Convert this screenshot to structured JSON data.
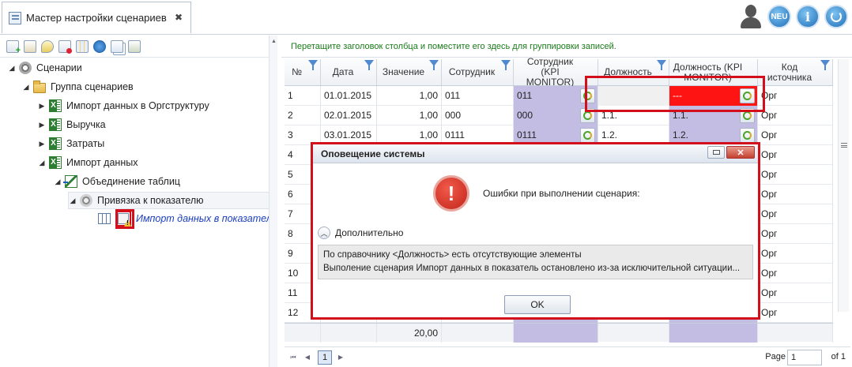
{
  "tab": {
    "title": "Мастер настройки сценариев",
    "close": "✖"
  },
  "top_icons": [
    "user-icon",
    "new-icon",
    "info-icon",
    "power-icon"
  ],
  "top_icon_text": {
    "new": "NEU",
    "info": "i"
  },
  "tree": {
    "root": "Сценарии",
    "group": "Группа сценариев",
    "items": [
      "Импорт данных в Оргструктуру",
      "Выручка",
      "Затраты",
      "Импорт данных"
    ],
    "merge": "Объединение таблиц",
    "bind": "Привязка к показателю",
    "import": "Импорт данных в показатель"
  },
  "grouping_hint": "Перетащите заголовок столбца и поместите его здесь для группировки записей.",
  "columns": [
    "№",
    "Дата",
    "Значение",
    "Сотрудник",
    "Сотрудник (KPI MONITOR)",
    "Должность",
    "Должность (KPI MONITOR)",
    "Код источника"
  ],
  "rows": [
    {
      "n": "1",
      "date": "01.01.2015",
      "value": "1,00",
      "emp": "011",
      "emp_kpi": "011",
      "pos": "",
      "pos_kpi": "---",
      "src": "Орг"
    },
    {
      "n": "2",
      "date": "02.01.2015",
      "value": "1,00",
      "emp": "000",
      "emp_kpi": "000",
      "pos": "1.1.",
      "pos_kpi": "1.1.",
      "src": "Орг"
    },
    {
      "n": "3",
      "date": "03.01.2015",
      "value": "1,00",
      "emp": "0111",
      "emp_kpi": "0111",
      "pos": "1.2.",
      "pos_kpi": "1.2.",
      "src": "Орг"
    },
    {
      "n": "4",
      "src": "Орг"
    },
    {
      "n": "5",
      "src": "Орг"
    },
    {
      "n": "6",
      "src": "Орг"
    },
    {
      "n": "7",
      "src": "Орг"
    },
    {
      "n": "8",
      "src": "Орг"
    },
    {
      "n": "9",
      "src": "Орг"
    },
    {
      "n": "10",
      "src": "Орг"
    },
    {
      "n": "11",
      "src": "Орг"
    },
    {
      "n": "12",
      "src": "Орг"
    }
  ],
  "total": "20,00",
  "pager": {
    "current": "1",
    "label": "Page",
    "input": "1",
    "of": "of 1",
    "first": "⏮",
    "prev": "◀",
    "next": "▶"
  },
  "dialog": {
    "title": "Оповещение системы",
    "error_mark": "!",
    "message": "Ошибки при выполнении сценария:",
    "more": "Дополнительно",
    "details": [
      "По справочнику <Должность> есть отсутствующие элементы",
      "Выполение сценария Импорт данных в показатель остановлено из-за исключительной ситуации..."
    ],
    "ok": "OK"
  },
  "colors": {
    "highlight": "#d30f1c",
    "error_cell": "#ff1414",
    "kpi_column": "#c3bde3",
    "hint_text": "#1a7a1a"
  }
}
